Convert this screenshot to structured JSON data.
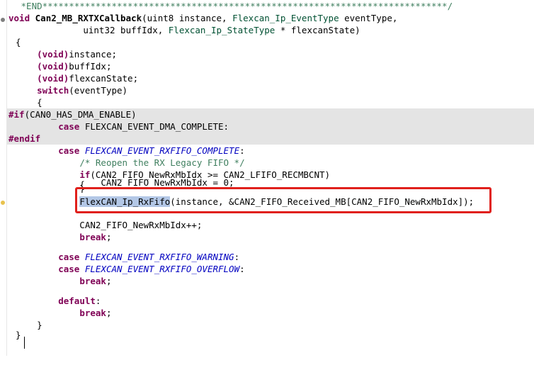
{
  "header_comment": " *END****************************************************************************/",
  "lines": {
    "sig1": [
      "void ",
      "Can2_MB_RXTXCallback",
      "(uint8 instance, ",
      "Flexcan_Ip_EventType",
      " eventType,"
    ],
    "sig2": [
      "              uint32 buffIdx, ",
      "Flexcan_Ip_StateType",
      " * flexcanState)"
    ],
    "l3": "{",
    "l4": [
      "    ",
      "(void)",
      "instance;"
    ],
    "l5": [
      "    ",
      "(void)",
      "buffIdx;"
    ],
    "l6": [
      "    ",
      "(void)",
      "flexcanState;"
    ],
    "l7": [
      "    ",
      "switch",
      "(eventType)"
    ],
    "l8": "    {",
    "l9": [
      "#if",
      "(CAN0_HAS_DMA_ENABLE)"
    ],
    "l10": [
      "        ",
      "case",
      " FLEXCAN_EVENT_DMA_COMPLETE:"
    ],
    "l11": "#endif",
    "l12": [
      "        ",
      "case",
      " ",
      "FLEXCAN_EVENT_RXFIFO_COMPLETE",
      ":"
    ],
    "l13": [
      "            ",
      "/* Reopen the RX Legacy FIFO */"
    ],
    "l14": [
      "            ",
      "if",
      "(CAN2_FIFO_NewRxMbIdx >= CAN2_LFIFO_RECMBCNT)"
    ],
    "l15": "            {",
    "l16": "                CAN2_FIFO_NewRxMbIdx = 0;",
    "l17": "            }",
    "l18": [
      "            ",
      "FlexCAN_Ip_RxFifo",
      "(instance, &CAN2_FIFO_Received_MB[CAN2_FIFO_NewRxMbIdx]);"
    ],
    "l19": "            CAN2_FIFO_NewRxMbIdx++;",
    "l20": [
      "            ",
      "break",
      ";"
    ],
    "l21": [
      "        ",
      "case",
      " ",
      "FLEXCAN_EVENT_RXFIFO_WARNING",
      ":"
    ],
    "l22": [
      "        ",
      "case",
      " ",
      "FLEXCAN_EVENT_RXFIFO_OVERFLOW",
      ":"
    ],
    "l23": [
      "            ",
      "break",
      ";"
    ],
    "l24": [
      "        ",
      "default",
      ":"
    ],
    "l25": [
      "            ",
      "break",
      ";"
    ],
    "l26": "    }",
    "l27": "}"
  },
  "icons": {
    "fold": "fold-collapse-icon",
    "warning": "warning-marker-icon"
  },
  "colors": {
    "keyword": "#7f0055",
    "type": "#005032",
    "enum": "#0000c0",
    "comment": "#3f7f5f",
    "disabled_bg": "#e4e4e4",
    "selection": "#b3c7e6",
    "annotation_box": "#e0201c"
  }
}
